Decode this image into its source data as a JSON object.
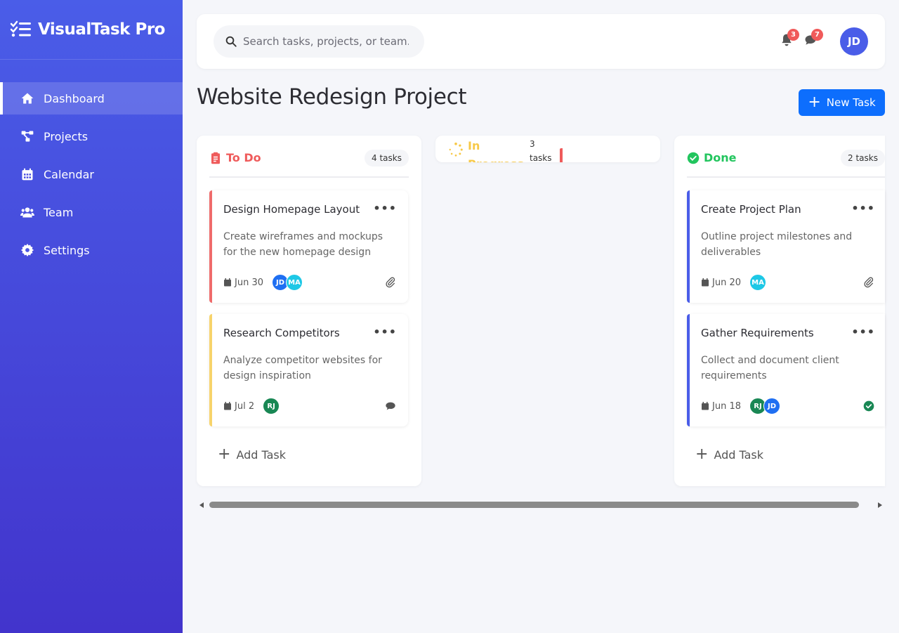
{
  "app": {
    "title": "VisualTask Pro"
  },
  "sidebar": {
    "items": [
      {
        "label": "Dashboard",
        "icon": "home-icon",
        "active": true
      },
      {
        "label": "Projects",
        "icon": "project-diagram-icon"
      },
      {
        "label": "Calendar",
        "icon": "calendar-icon"
      },
      {
        "label": "Team",
        "icon": "users-icon"
      },
      {
        "label": "Settings",
        "icon": "gear-icon"
      }
    ]
  },
  "header": {
    "search_placeholder": "Search tasks, projects, or team...",
    "notifications_count": "3",
    "messages_count": "7",
    "user_initials": "JD"
  },
  "page": {
    "title": "Website Redesign Project",
    "new_task_label": "New Task"
  },
  "columns": {
    "todo": {
      "title": "To Do",
      "count": "4 tasks",
      "cards": [
        {
          "title": "Design Homepage Layout",
          "description": "Create wireframes and mockups for the new homepage design",
          "due": "Jun 30",
          "assignees": [
            "JD",
            "MA"
          ],
          "icon": "paperclip-icon",
          "stripe": "#ef6b6b"
        },
        {
          "title": "Research Competitors",
          "description": "Analyze competitor websites for design inspiration",
          "due": "Jul 2",
          "assignees": [
            "RJ"
          ],
          "icon": "comment-icon",
          "stripe": "#f7d36b"
        }
      ],
      "add_label": "Add Task"
    },
    "in_progress": {
      "title": "In Progress",
      "count": "3 tasks"
    },
    "done": {
      "title": "Done",
      "count": "2 tasks",
      "cards": [
        {
          "title": "Create Project Plan",
          "description": "Outline project milestones and deliverables",
          "due": "Jun 20",
          "assignees": [
            "MA"
          ],
          "icon": "paperclip-icon",
          "stripe": "#4a5de8"
        },
        {
          "title": "Gather Requirements",
          "description": "Collect and document client requirements",
          "due": "Jun 18",
          "assignees": [
            "RJ",
            "JD"
          ],
          "icon": "check-circle-icon",
          "stripe": "#4a5de8"
        }
      ],
      "add_label": "Add Task"
    }
  },
  "colors": {
    "accent": "#4a5de8",
    "primary_button": "#0d6efd",
    "todo": "#ef5b5b",
    "in_progress": "#f7c948",
    "done": "#22c55e"
  }
}
